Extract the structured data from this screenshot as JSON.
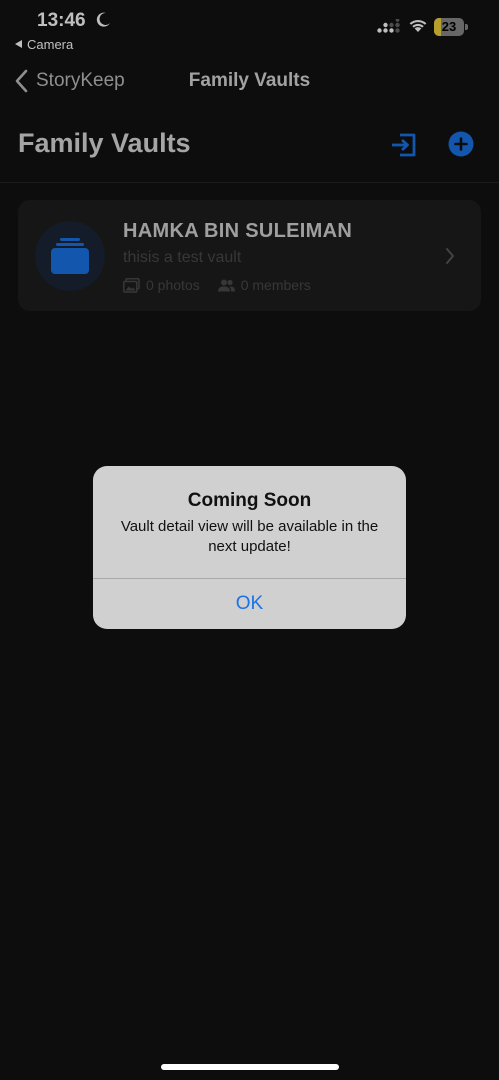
{
  "status_bar": {
    "time": "13:46",
    "back_app": "Camera",
    "battery": "23",
    "battery_level": 0.23
  },
  "nav": {
    "back_label": "StoryKeep",
    "title": "Family Vaults"
  },
  "header": {
    "title": "Family Vaults"
  },
  "vaults": [
    {
      "name": "HAMKA BIN SULEIMAN",
      "description": "thisis a test vault",
      "photos": "0 photos",
      "members": "0 members"
    }
  ],
  "alert": {
    "title": "Coming Soon",
    "message": "Vault detail view will be available in the next update!",
    "ok_label": "OK"
  },
  "colors": {
    "accent": "#1a73e8",
    "background": "#121212",
    "card": "#1e1e1e"
  }
}
